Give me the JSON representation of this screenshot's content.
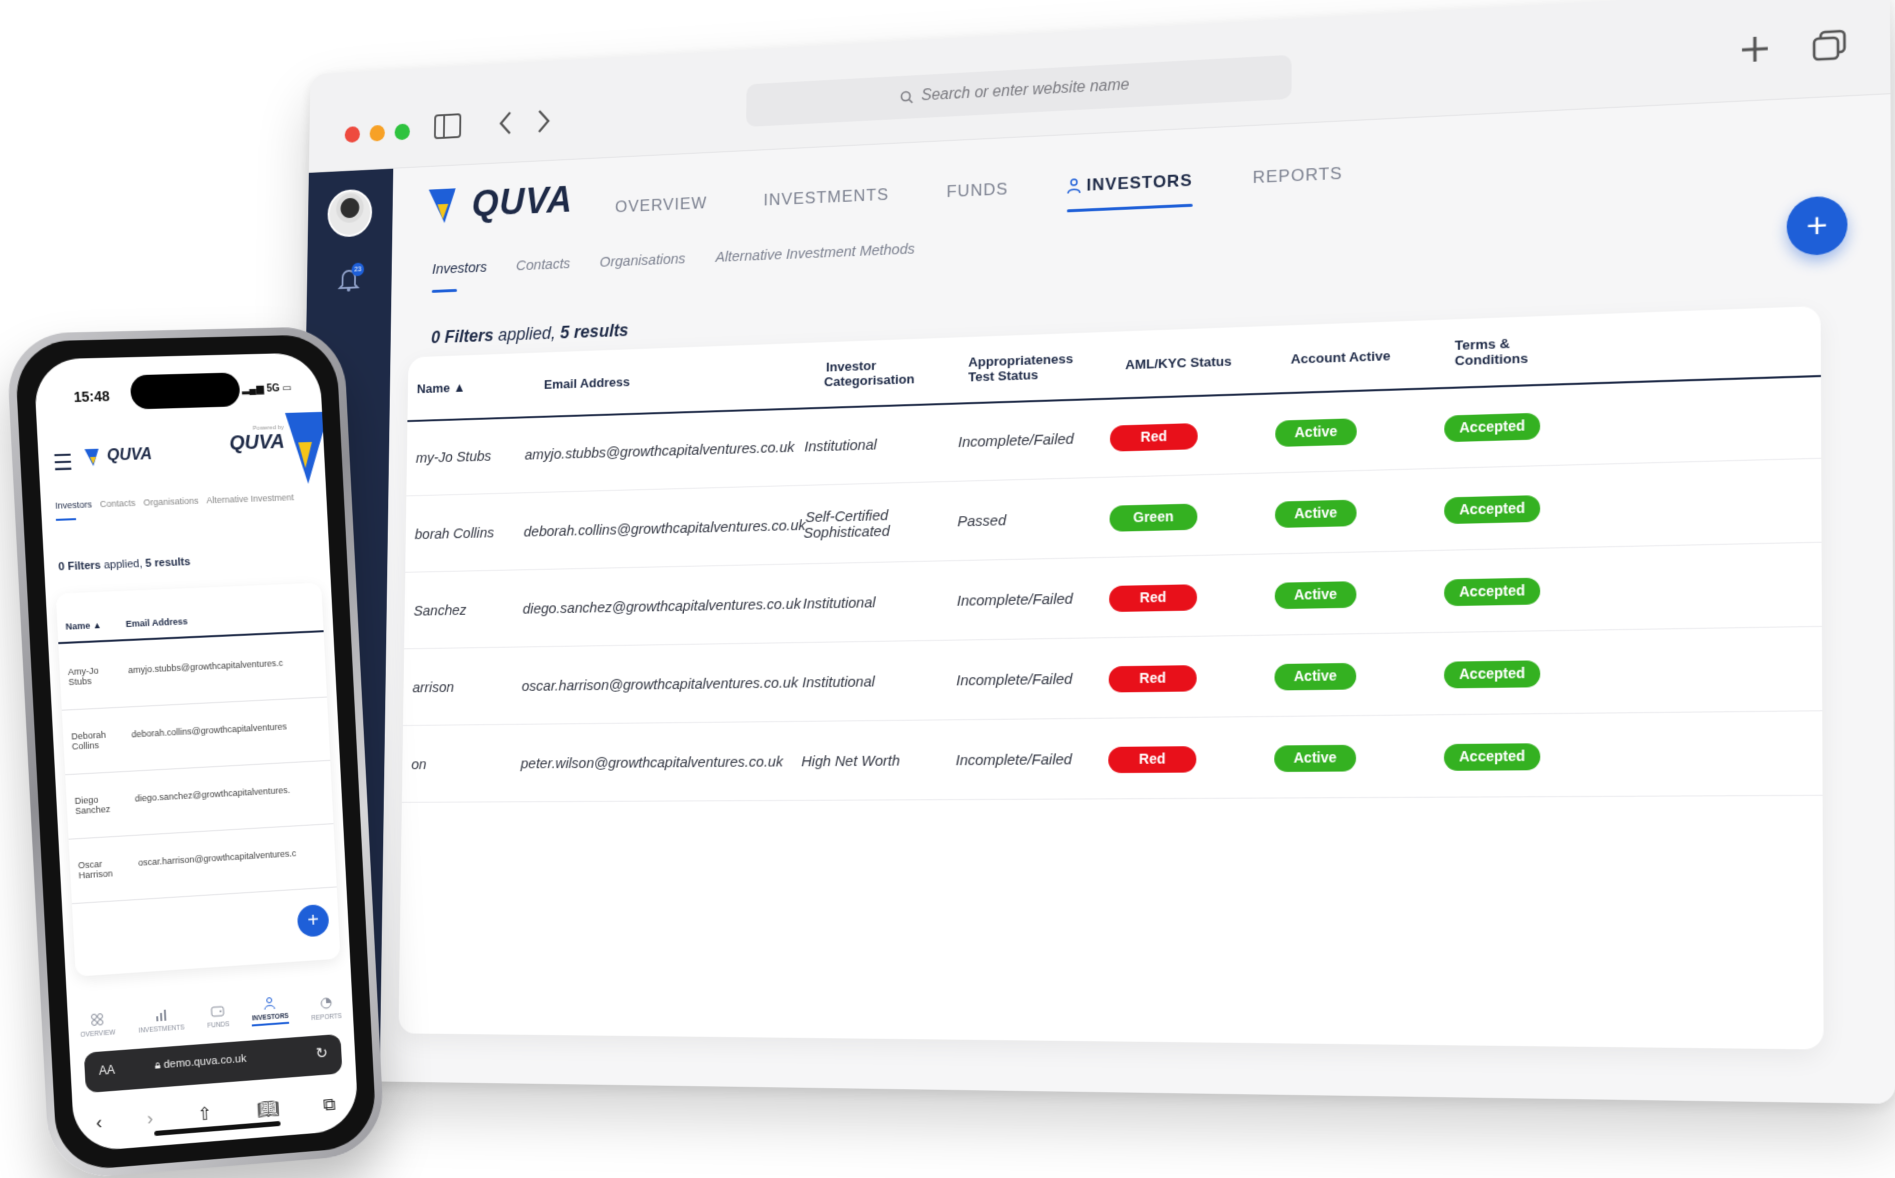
{
  "browser": {
    "url_placeholder": "Search or enter website name",
    "new_tab_icon": "plus-icon",
    "tabs_icon": "tabs-overview-icon",
    "back_icon": "chevron-left-icon",
    "forward_icon": "chevron-right-icon",
    "sidebar_toggle_icon": "sidebar-toggle-icon"
  },
  "app": {
    "logo_text": "QUVA",
    "notification_count": "23",
    "nav": [
      {
        "label": "OVERVIEW"
      },
      {
        "label": "INVESTMENTS"
      },
      {
        "label": "FUNDS"
      },
      {
        "label": "INVESTORS"
      },
      {
        "label": "REPORTS"
      }
    ],
    "active_nav": "INVESTORS",
    "subnav": [
      {
        "label": "Investors"
      },
      {
        "label": "Contacts"
      },
      {
        "label": "Organisations"
      },
      {
        "label": "Alternative Investment Methods"
      }
    ],
    "filters_count": "0 Filters",
    "filters_mid": " applied, ",
    "results": "5 results",
    "fab_label": "+",
    "colors": {
      "navy": "#1e2a47",
      "accent": "#1e5fd8",
      "red": "#e8101a",
      "green": "#34b121"
    }
  },
  "table": {
    "headers": {
      "name": "Name ▲",
      "email": "Email Address",
      "categorisation_1": "Investor",
      "categorisation_2": "Categorisation",
      "appropriateness_1": "Appropriateness",
      "appropriateness_2": "Test Status",
      "aml": "AML/KYC Status",
      "account": "Account Active",
      "terms_1": "Terms &",
      "terms_2": "Conditions"
    },
    "rows": [
      {
        "name": "my-Jo Stubs",
        "email": "amyjo.stubbs@growthcapitalventures.co.uk",
        "cat_1": "Institutional",
        "cat_2": "",
        "test": "Incomplete/Failed",
        "aml": "Red",
        "account": "Active",
        "terms": "Accepted"
      },
      {
        "name": "borah Collins",
        "email": "deborah.collins@growthcapitalventures.co.uk",
        "cat_1": "Self-Certified",
        "cat_2": "Sophisticated",
        "test": "Passed",
        "aml": "Green",
        "account": "Active",
        "terms": "Accepted"
      },
      {
        "name": "Sanchez",
        "email": "diego.sanchez@growthcapitalventures.co.uk",
        "cat_1": "Institutional",
        "cat_2": "",
        "test": "Incomplete/Failed",
        "aml": "Red",
        "account": "Active",
        "terms": "Accepted"
      },
      {
        "name": "arrison",
        "email": "oscar.harrison@growthcapitalventures.co.uk",
        "cat_1": "Institutional",
        "cat_2": "",
        "test": "Incomplete/Failed",
        "aml": "Red",
        "account": "Active",
        "terms": "Accepted"
      },
      {
        "name": "on",
        "email": "peter.wilson@growthcapitalventures.co.uk",
        "cat_1": "High Net Worth",
        "cat_2": "",
        "test": "Incomplete/Failed",
        "aml": "Red",
        "account": "Active",
        "terms": "Accepted"
      }
    ]
  },
  "phone": {
    "time": "15:48",
    "signal": "5G",
    "logo_text": "QUVA",
    "powered_by": "Powered by",
    "powered_logo": "QUVA",
    "subnav": [
      "Investors",
      "Contacts",
      "Organisations",
      "Alternative Investment"
    ],
    "filters_count": "0 Filters",
    "filters_mid": " applied, ",
    "results": "5 results",
    "header_name": "Name ▲",
    "header_email": "Email Address",
    "rows": [
      {
        "name_1": "Amy-Jo",
        "name_2": "Stubs",
        "email": "amyjo.stubbs@growthcapitalventures.c"
      },
      {
        "name_1": "Deborah",
        "name_2": "Collins",
        "email": "deborah.collins@growthcapitalventures"
      },
      {
        "name_1": "Diego",
        "name_2": "Sanchez",
        "email": "diego.sanchez@growthcapitalventures."
      },
      {
        "name_1": "Oscar",
        "name_2": "Harrison",
        "email": "oscar.harrison@growthcapitalventures.c"
      }
    ],
    "bottom_nav": [
      {
        "label": "OVERVIEW",
        "icon": "grid-icon"
      },
      {
        "label": "INVESTMENTS",
        "icon": "bar-chart-icon"
      },
      {
        "label": "FUNDS",
        "icon": "wallet-icon"
      },
      {
        "label": "INVESTORS",
        "icon": "person-icon"
      },
      {
        "label": "REPORTS",
        "icon": "pie-chart-icon"
      }
    ],
    "safari_aa": "AA",
    "safari_domain": "demo.quva.co.uk",
    "fab_label": "+"
  }
}
